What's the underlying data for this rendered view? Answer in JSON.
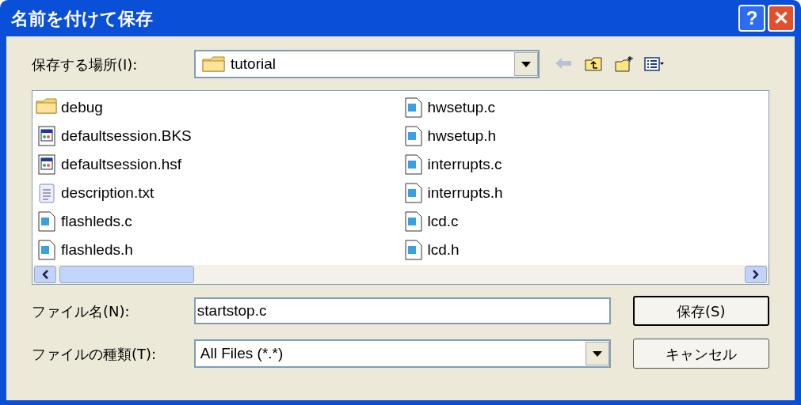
{
  "window": {
    "title": "名前を付けて保存"
  },
  "title_buttons": [
    {
      "kind": "help",
      "label": "?"
    },
    {
      "kind": "close",
      "label": "✕"
    }
  ],
  "location": {
    "label": "保存する場所(I):",
    "value": "tutorial"
  },
  "toolbar": [
    {
      "kind": "back",
      "disabled": true
    },
    {
      "kind": "up",
      "disabled": false
    },
    {
      "kind": "new-folder",
      "disabled": false
    },
    {
      "kind": "view",
      "disabled": false
    }
  ],
  "files": [
    {
      "name": "debug",
      "kind": "folder"
    },
    {
      "name": "defaultsession.BKS",
      "kind": "session"
    },
    {
      "name": "defaultsession.hsf",
      "kind": "session"
    },
    {
      "name": "description.txt",
      "kind": "text"
    },
    {
      "name": "flashleds.c",
      "kind": "source"
    },
    {
      "name": "flashleds.h",
      "kind": "source"
    },
    {
      "name": "hwsetup.c",
      "kind": "source"
    },
    {
      "name": "hwsetup.h",
      "kind": "source"
    },
    {
      "name": "interrupts.c",
      "kind": "source"
    },
    {
      "name": "interrupts.h",
      "kind": "source"
    },
    {
      "name": "lcd.c",
      "kind": "source"
    },
    {
      "name": "lcd.h",
      "kind": "source"
    }
  ],
  "file_name": {
    "label": "ファイル名(N):",
    "value": "startstop.c"
  },
  "file_type": {
    "label": "ファイルの種類(T):",
    "value": "All Files (*.*)"
  },
  "buttons": [
    {
      "label": "保存(S)",
      "default": true
    },
    {
      "label": "キャンセル",
      "default": false
    }
  ]
}
